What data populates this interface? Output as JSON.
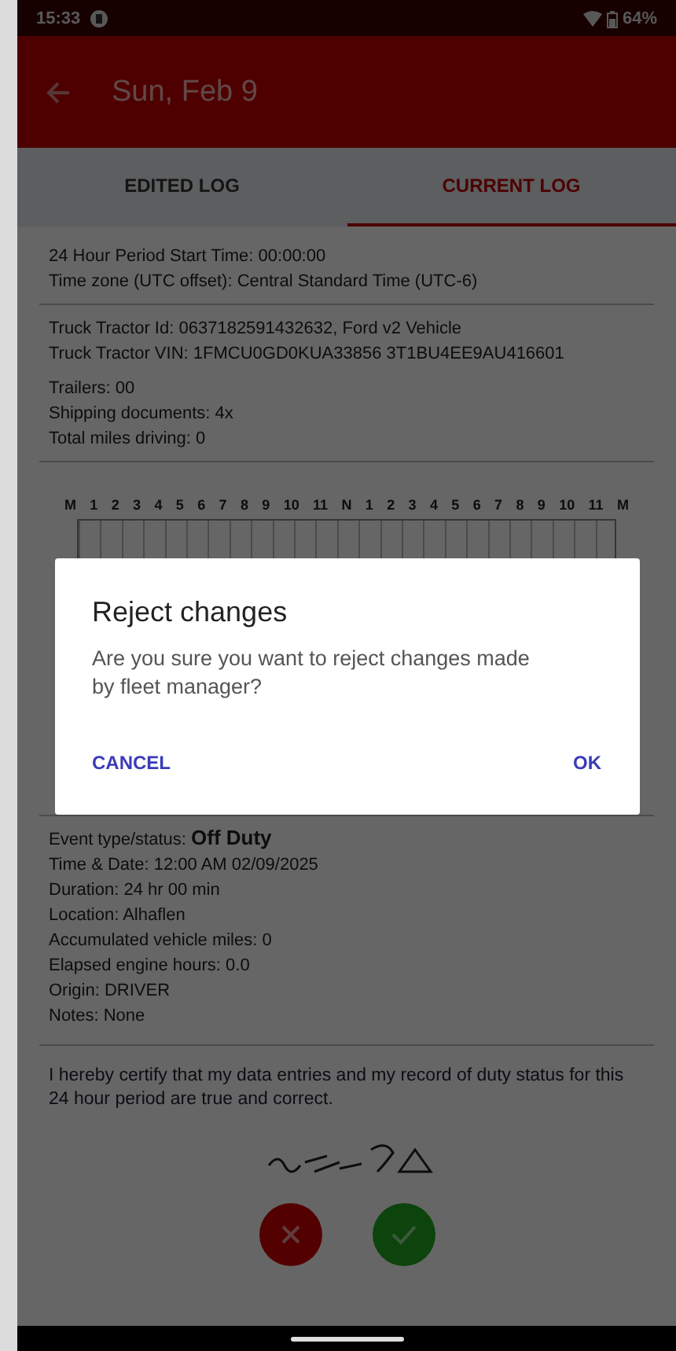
{
  "status_bar": {
    "time": "15:33",
    "battery": "64%"
  },
  "app_bar": {
    "title": "Sun, Feb 9"
  },
  "tabs": [
    {
      "label": "EDITED LOG",
      "selected": false
    },
    {
      "label": "CURRENT LOG",
      "selected": true
    }
  ],
  "period_fields": [
    {
      "label": "24 Hour Period Start Time:",
      "value": "00:00:00",
      "bold_value": false
    },
    {
      "label": "Time zone (UTC offset):",
      "value": "Central Standard Time (UTC-6)",
      "bold_value": false
    }
  ],
  "truck_fields": [
    {
      "label": "Truck Tractor Id:",
      "value": "0637182591432632, Ford v2 Vehicle",
      "bold_value": false
    },
    {
      "label": "Truck Tractor VIN:",
      "value": "1FMCU0GD0KUA33856 3T1BU4EE9AU416601",
      "bold_value": false
    }
  ],
  "trip_fields": [
    {
      "label": "Trailers:",
      "value": "00",
      "bold_value": false
    },
    {
      "label": "Shipping documents:",
      "value": "4x",
      "bold_value": false
    },
    {
      "label": "Total miles driving:",
      "value": "0",
      "bold_value": false
    }
  ],
  "chart": {
    "hour_labels": [
      "M",
      "1",
      "2",
      "3",
      "4",
      "5",
      "6",
      "7",
      "8",
      "9",
      "10",
      "11",
      "N",
      "1",
      "2",
      "3",
      "4",
      "5",
      "6",
      "7",
      "8",
      "9",
      "10",
      "11",
      "M"
    ]
  },
  "event_fields": [
    {
      "label": "Event type/status:",
      "value": "Off Duty",
      "bold_value": true
    },
    {
      "label": "Time & Date:",
      "value": "12:00 AM 02/09/2025",
      "bold_value": false
    },
    {
      "label": "Duration:",
      "value": "24 hr 00 min",
      "bold_value": false
    },
    {
      "label": "Location:",
      "value": "Alhaflen",
      "bold_value": false
    },
    {
      "label": "Accumulated vehicle miles:",
      "value": "0",
      "bold_value": false
    },
    {
      "label": "Elapsed engine hours:",
      "value": "0.0",
      "bold_value": false
    },
    {
      "label": "Origin:",
      "value": "DRIVER",
      "bold_value": false
    },
    {
      "label": "Notes:",
      "value": "None",
      "bold_value": false
    }
  ],
  "certification": "I hereby certify that my data entries and my record of duty status for this 24 hour period are true and correct.",
  "actions": [
    {
      "kind": "reject"
    },
    {
      "kind": "accept"
    }
  ],
  "dialog": {
    "title": "Reject changes",
    "message": "Are you sure you want to reject changes made by fleet manager?",
    "buttons": [
      "CANCEL",
      "OK"
    ]
  }
}
